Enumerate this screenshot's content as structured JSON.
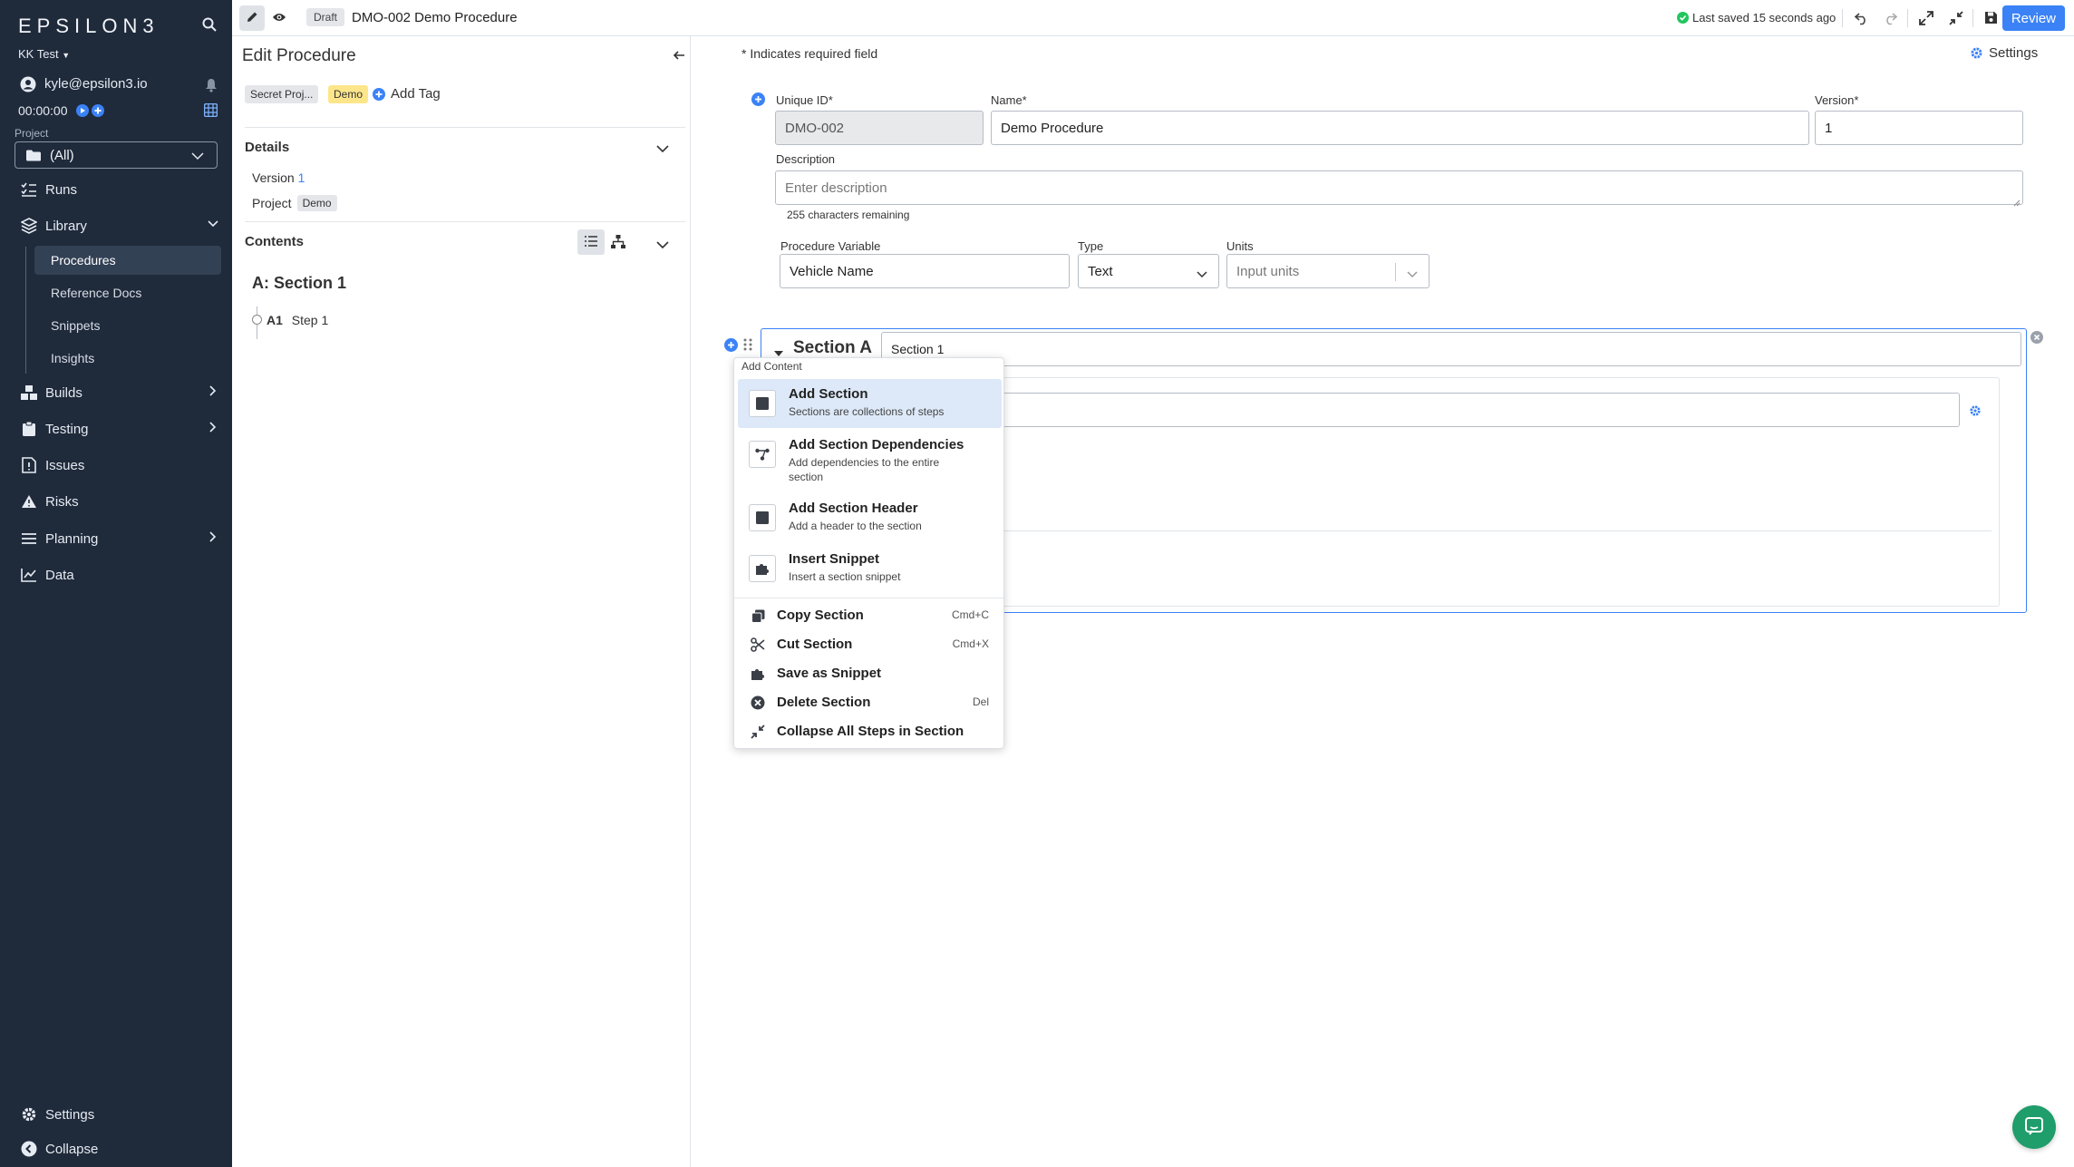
{
  "sidebar": {
    "logo": "EPSILON3",
    "workspace": "KK Test",
    "user_email": "kyle@epsilon3.io",
    "timer": "00:00:00",
    "project_label": "Project",
    "project_value": "(All)",
    "nav": {
      "runs": "Runs",
      "library": "Library",
      "builds": "Builds",
      "testing": "Testing",
      "issues": "Issues",
      "risks": "Risks",
      "planning": "Planning",
      "data": "Data",
      "settings": "Settings",
      "collapse": "Collapse"
    },
    "library_items": [
      "Procedures",
      "Reference Docs",
      "Snippets",
      "Insights"
    ]
  },
  "topbar": {
    "status": "Draft",
    "title": "DMO-002 Demo Procedure",
    "last_saved": "Last saved 15 seconds ago",
    "review": "Review"
  },
  "left_panel": {
    "title": "Edit Procedure",
    "tags": [
      "Secret Proj...",
      "Demo"
    ],
    "add_tag": "Add Tag",
    "details_header": "Details",
    "version_label": "Version",
    "version_value": "1",
    "project_label": "Project",
    "project_value": "Demo",
    "contents_header": "Contents",
    "section_title": "A: Section 1",
    "step_id": "A1",
    "step_name": "Step 1"
  },
  "main": {
    "required_note": "* Indicates required field",
    "settings": "Settings",
    "unique_id_label": "Unique ID*",
    "unique_id_value": "DMO-002",
    "name_label": "Name*",
    "name_value": "Demo Procedure",
    "version_label": "Version*",
    "version_value": "1",
    "description_label": "Description",
    "description_placeholder": "Enter description",
    "chars_remaining": "255 characters remaining",
    "proc_var_label": "Procedure Variable",
    "proc_var_value": "Vehicle Name",
    "type_label": "Type",
    "type_value": "Text",
    "units_label": "Units",
    "units_placeholder": "Input units",
    "section_label": "Section A",
    "section_name": "Section 1"
  },
  "menu": {
    "header": "Add Content",
    "big_items": [
      {
        "title": "Add Section",
        "desc": "Sections are collections of steps"
      },
      {
        "title": "Add Section Dependencies",
        "desc": "Add dependencies to the entire section"
      },
      {
        "title": "Add Section Header",
        "desc": "Add a header to the section"
      },
      {
        "title": "Insert Snippet",
        "desc": "Insert a section snippet"
      }
    ],
    "small_items": [
      {
        "title": "Copy Section",
        "shortcut": "Cmd+C"
      },
      {
        "title": "Cut Section",
        "shortcut": "Cmd+X"
      },
      {
        "title": "Save as Snippet",
        "shortcut": ""
      },
      {
        "title": "Delete Section",
        "shortcut": "Del"
      },
      {
        "title": "Collapse All Steps in Section",
        "shortcut": ""
      }
    ]
  }
}
